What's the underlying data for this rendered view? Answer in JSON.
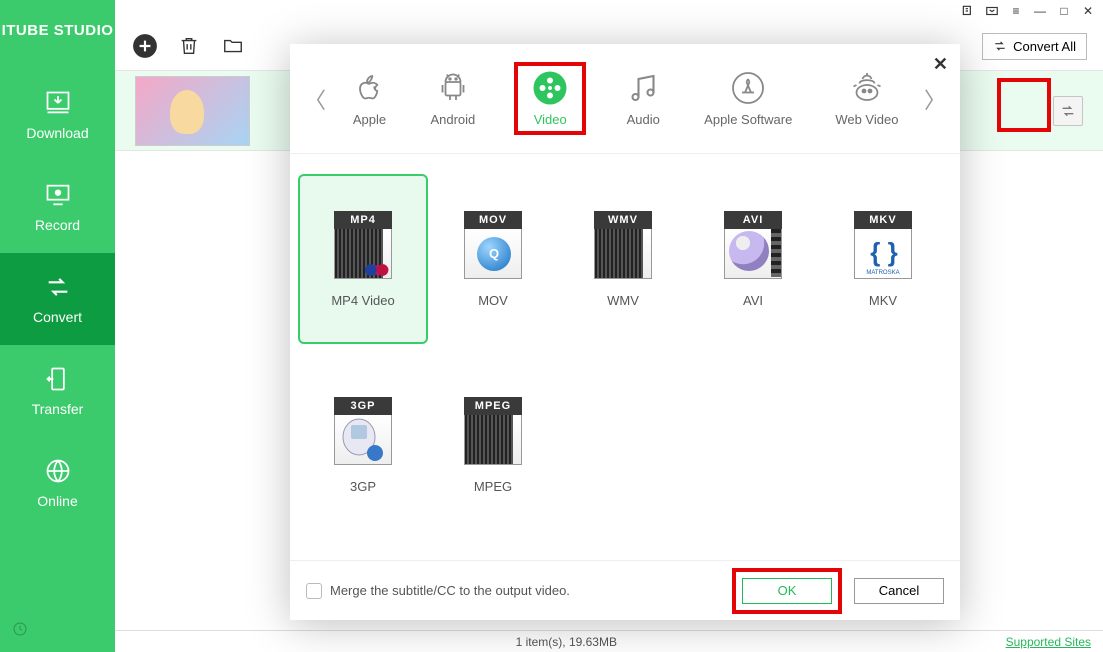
{
  "app_title": "ITUBE STUDIO",
  "nav": {
    "download": "Download",
    "record": "Record",
    "convert": "Convert",
    "transfer": "Transfer",
    "online": "Online"
  },
  "toolbar": {
    "convert_all": "Convert All"
  },
  "modal": {
    "tabs": {
      "apple": "Apple",
      "android": "Android",
      "video": "Video",
      "audio": "Audio",
      "apple_software": "Apple Software",
      "web_video": "Web Video"
    },
    "formats": {
      "mp4": "MP4 Video",
      "mov": "MOV",
      "wmv": "WMV",
      "avi": "AVI",
      "mkv": "MKV",
      "3gp": "3GP",
      "mpeg": "MPEG",
      "badge_mp4": "MP4",
      "badge_mov": "MOV",
      "badge_wmv": "WMV",
      "badge_avi": "AVI",
      "badge_mkv": "MKV",
      "badge_3gp": "3GP",
      "badge_mpeg": "MPEG",
      "mkv_sub": "MATROSKA"
    },
    "merge_label": "Merge the subtitle/CC to the output video.",
    "ok": "OK",
    "cancel": "Cancel"
  },
  "status": {
    "center": "1 item(s), 19.63MB",
    "supported": "Supported Sites"
  }
}
